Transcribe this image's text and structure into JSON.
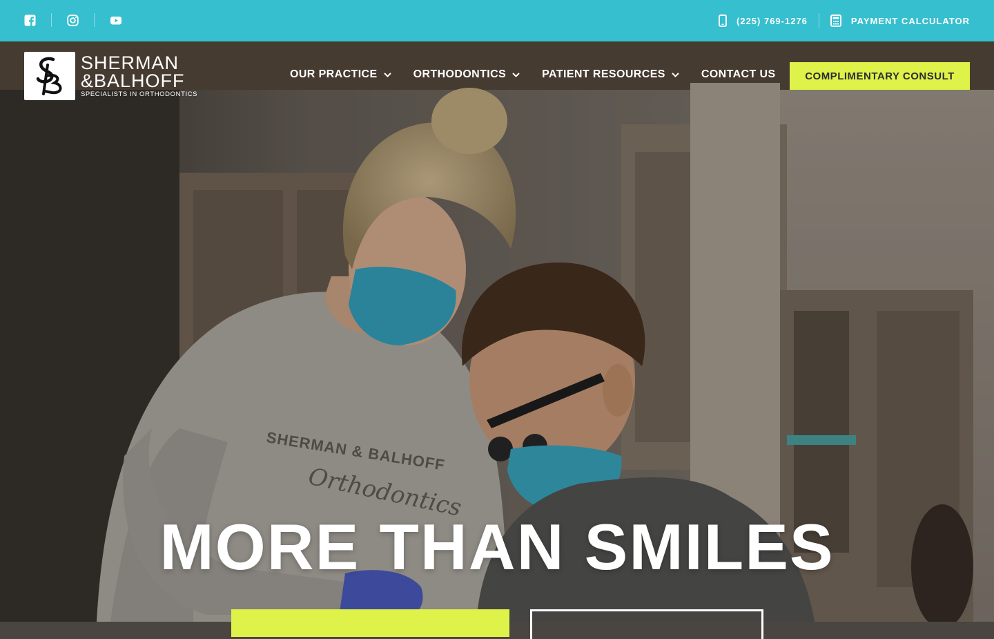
{
  "topbar": {
    "social": [
      {
        "icon": "facebook-icon"
      },
      {
        "icon": "instagram-icon"
      },
      {
        "icon": "youtube-icon"
      }
    ],
    "phone_label": "(225) 769-1276",
    "payment_label": "PAYMENT CALCULATOR"
  },
  "logo": {
    "line1": "SHERMAN",
    "line2": "&BALHOFF",
    "line3": "SPECIALISTS IN ORTHODONTICS"
  },
  "nav": {
    "items": [
      {
        "label": "OUR PRACTICE",
        "dropdown": true
      },
      {
        "label": "ORTHODONTICS",
        "dropdown": true
      },
      {
        "label": "PATIENT RESOURCES",
        "dropdown": true
      },
      {
        "label": "CONTACT US",
        "dropdown": false
      }
    ],
    "cta_label": "COMPLIMENTARY CONSULT"
  },
  "hero": {
    "headline": "MORE THAN SMILES",
    "shirt_text_1": "SHERMAN & BALHOFF",
    "shirt_text_2": "Orthodontics"
  },
  "colors": {
    "topbar": "#35bfcf",
    "accent": "#dff24a",
    "text": "#ffffff"
  }
}
